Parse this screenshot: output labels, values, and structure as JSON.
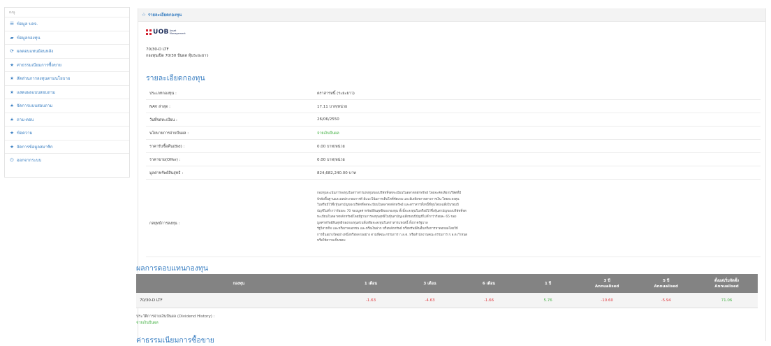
{
  "sidebar": {
    "header": "เมนู",
    "items": [
      {
        "label": "ข้อมูล บลจ.",
        "icon": "list-icon",
        "glyph": "☰"
      },
      {
        "label": "ข้อมูลกองทุน",
        "icon": "folder-icon",
        "glyph": "▰"
      },
      {
        "label": "ผลตอบแทนย้อนหลัง",
        "icon": "refresh-icon",
        "glyph": "⟳"
      },
      {
        "label": "ค่าธรรมเนียมการซื้อขาย",
        "icon": "star-icon",
        "glyph": "★"
      },
      {
        "label": "สัดส่วนการลงทุนตามนโยบาย",
        "icon": "star-icon",
        "glyph": "★"
      },
      {
        "label": "แสดงผลแบบสอบถาม",
        "icon": "star-icon",
        "glyph": "★"
      },
      {
        "label": "จัดการแบบสอบถาม",
        "icon": "star-icon",
        "glyph": "★"
      },
      {
        "label": "ถาม-ตอบ",
        "icon": "star-icon",
        "glyph": "★"
      },
      {
        "label": "ข้อความ",
        "icon": "star-icon",
        "glyph": "★"
      },
      {
        "label": "จัดการข้อมูลสมาชิก",
        "icon": "star-icon",
        "glyph": "★"
      },
      {
        "label": "ออกจากระบบ",
        "icon": "power-icon",
        "glyph": "⏻"
      }
    ]
  },
  "panel": {
    "title": "รายละเอียดกองทุน",
    "title_icon": "star-icon",
    "logo_text": "UOB",
    "logo_sub": "Asset Management",
    "fund_code": "70/30-D LTF",
    "fund_name": "กองทุนเปิด 70/30 ปันผล หุ้นระยะยาว"
  },
  "detail": {
    "heading": "รายละเอียดกองทุน",
    "rows": [
      {
        "label": "ประเภทกองทุน :",
        "value": "ตราสารหนี้ (ระยะยาว)"
      },
      {
        "label": "NAV ล่าสุด :",
        "value": "17.11 บาท/หน่วย"
      },
      {
        "label": "วันที่จดทะเบียน :",
        "value": "26/06/2550"
      },
      {
        "label": "นโยบายการจ่ายปันผล :",
        "value": "จ่ายเงินปันผล"
      },
      {
        "label": "ราคารับซื้อคืน(Bid) :",
        "value": "0.00 บาท/หน่วย"
      },
      {
        "label": "ราคาขาย(Offer) :",
        "value": "0.00 บาท/หน่วย"
      },
      {
        "label": "มูลค่าทรัพย์สินสุทธิ :",
        "value": "824,682,240.00 บาท"
      }
    ],
    "policy_label": "กลยุทธ์การลงทุน :",
    "policy_text": "กองทุนจะเน้นการลงทุนในตราสารแห่งทุนของบริษัทที่จดทะเบียนในตลาดหลักทรัพย์ โดยจะคัดเลือกบริษัทที่มี\nปัจจัยพื้นฐานและผลประกอบการดี มีแนวโน้มการเติบโตที่ชัดเจน และมีเสถียรภาพทางการเงิน โดยจะลงทุน\nในหรือมีไว้ซึ่งหุ้นสามัญของบริษัทที่จดทะเบียนในตลาดหลักทรัพย์ และตราสารทั้งหนี้ที่ทุนโดยเฉลี่ยในรอบปี\nบัญชีไม่ต่ำกว่าร้อยละ 70 ของมูลค่าทรัพย์สินสุทธิของกองทุน ทั้งนี้จะลงทุนในหรือมีไว้ซึ่งหุ้นสามัญของบริษัทที่จด\nทะเบียนในตลาดหลักทรัพย์โดยมีฐานการลงทุนสุทธิในหุ้นสามัญเฉลี่ยรอบปีบัญชีไม่ต่ำกว่าร้อยละ 65 ของ\nมูลค่าทรัพย์สินสุทธิของกองทุนส่วนที่เหลือจะลงทุนในตราสารแห่งหนี้ ทั้งภาครัฐบาล\nรัฐวิสาหกิจ และหรือภาคเอกชน และหรือเงินฝาก หรือหลักทรัพย์ หรือทรัพย์สินอื่นหรือการหาดอกผลโดยวิธี\nการอื่นอย่างใดอย่างหนึ่งหรือหลายอย่าง ตามที่คณะกรรมการ ก.ล.ต. หรือสำนักงานคณะกรรมการ ก.ล.ต.กำหนด\nหรือให้ความเห็นชอบ"
  },
  "performance": {
    "heading": "ผลการดอบแทนกองทุน",
    "headers": [
      {
        "line1": "กองทุน",
        "line2": ""
      },
      {
        "line1": "1 เดือน",
        "line2": ""
      },
      {
        "line1": "3 เดือน",
        "line2": ""
      },
      {
        "line1": "6 เดือน",
        "line2": ""
      },
      {
        "line1": "1 ปี",
        "line2": ""
      },
      {
        "line1": "3 ปี",
        "line2": "Annualised"
      },
      {
        "line1": "5 ปี",
        "line2": "Annualised"
      },
      {
        "line1": "ตั้งแต่เริ่มจัดตั้ง",
        "line2": "Annualised"
      }
    ],
    "rows": [
      {
        "fund": "70/30-D LTF",
        "values": [
          "-1.63",
          "-4.63",
          "-1.66",
          "5.76",
          "-10.60",
          "-5.94",
          "71.06"
        ]
      }
    ],
    "dividend_label": "ประวัติการจ่ายเงินปันผล (Dividend History) :",
    "dividend_value": "จ่ายเงินปันผล"
  },
  "fees": {
    "heading": "ค่าธรรมเนียมการซื้อขาย"
  },
  "colors": {
    "accent": "#3a7fc2",
    "positive": "#46b246",
    "negative": "#e0393e",
    "table_header": "#838383",
    "brand_red": "#d2212f",
    "brand_navy": "#1d2d5a"
  }
}
